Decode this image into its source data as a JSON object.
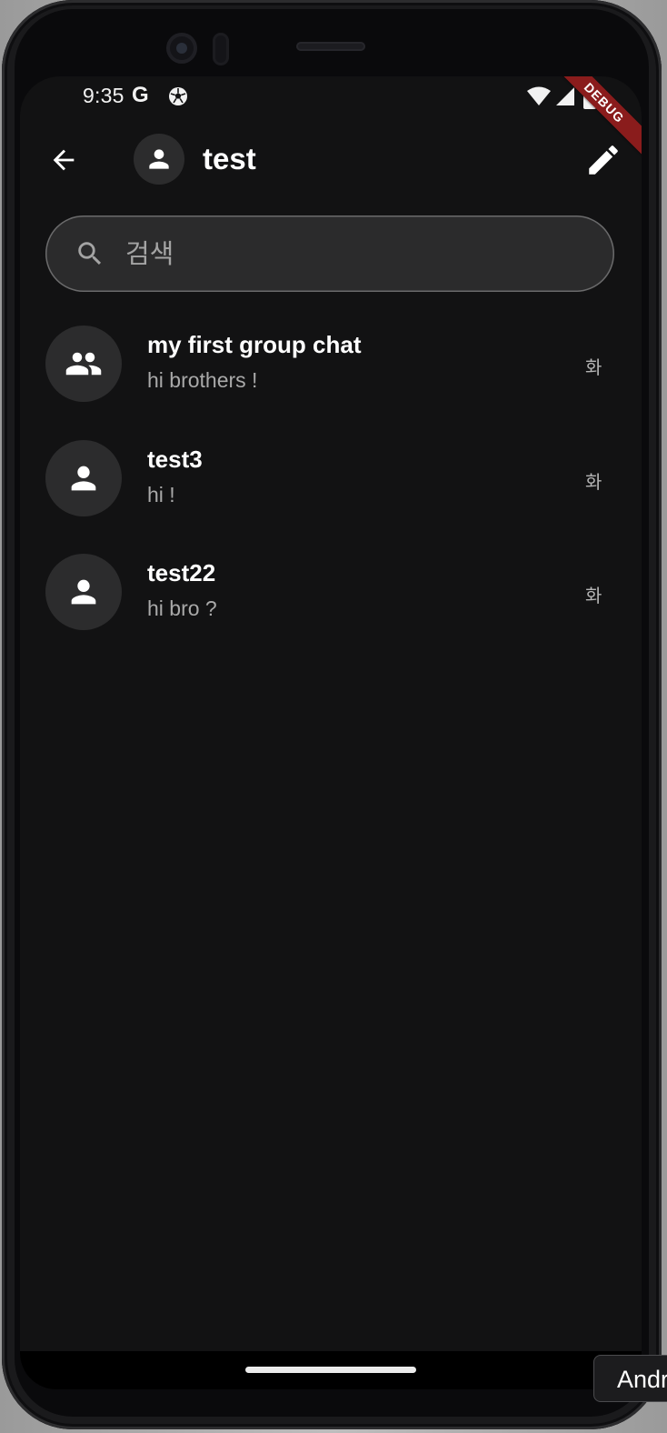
{
  "status_bar": {
    "time": "9:35",
    "g_label": "G",
    "icons": [
      "soccer-ball-icon",
      "wifi-icon",
      "signal-icon",
      "battery-icon"
    ]
  },
  "debug_banner": "DEBUG",
  "app_bar": {
    "title": "test",
    "icons": [
      "back-arrow-icon",
      "person-icon",
      "edit-pencil-icon"
    ]
  },
  "search": {
    "placeholder": "검색",
    "value": ""
  },
  "chats": [
    {
      "name": "my first group chat",
      "preview": "hi brothers !",
      "time": "화",
      "avatar_icon": "group-icon"
    },
    {
      "name": "test3",
      "preview": "hi !",
      "time": "화",
      "avatar_icon": "person-icon"
    },
    {
      "name": "test22",
      "preview": "hi bro ?",
      "time": "화",
      "avatar_icon": "person-icon"
    }
  ],
  "side_tab_label": "Android",
  "colors": {
    "background": "#121213",
    "surface": "#2c2c2d",
    "text_primary": "#ffffff",
    "text_secondary": "#a9a9a9",
    "debug_ribbon": "#8a1c1c"
  }
}
